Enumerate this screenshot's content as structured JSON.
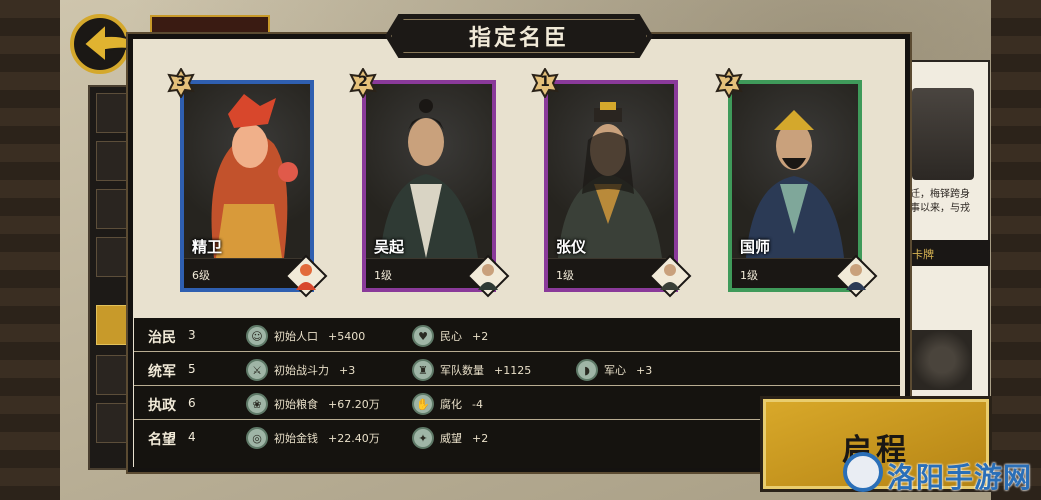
{
  "dialog": {
    "title": "指定名臣"
  },
  "cards": [
    {
      "name": "精卫",
      "level": "6级",
      "rank": "3",
      "border_color": "#2f5fb0"
    },
    {
      "name": "吴起",
      "level": "1级",
      "rank": "2",
      "border_color": "#8a3a9a"
    },
    {
      "name": "张仪",
      "level": "1级",
      "rank": "1",
      "border_color": "#8a3a9a"
    },
    {
      "name": "国师",
      "level": "1级",
      "rank": "2",
      "border_color": "#3f9a5a"
    }
  ],
  "stats": [
    {
      "name": "治民",
      "value": "3",
      "bonuses": [
        {
          "icon": "person-icon",
          "label": "初始人口",
          "amount": "+5400"
        },
        {
          "icon": "heart-icon",
          "label": "民心",
          "amount": "+2"
        }
      ]
    },
    {
      "name": "统军",
      "value": "5",
      "bonuses": [
        {
          "icon": "sword-icon",
          "label": "初始战斗力",
          "amount": "+3"
        },
        {
          "icon": "soldier-icon",
          "label": "军队数量",
          "amount": "+1125"
        },
        {
          "icon": "helmet-icon",
          "label": "军心",
          "amount": "+3"
        }
      ]
    },
    {
      "name": "执政",
      "value": "6",
      "bonuses": [
        {
          "icon": "grain-icon",
          "label": "初始粮食",
          "amount": "+67.20万"
        },
        {
          "icon": "corruption-icon",
          "label": "腐化",
          "amount": "-4"
        }
      ]
    },
    {
      "name": "名望",
      "value": "4",
      "bonuses": [
        {
          "icon": "coin-icon",
          "label": "初始金钱",
          "amount": "+22.40万"
        },
        {
          "icon": "prestige-icon",
          "label": "威望",
          "amount": "+2"
        }
      ]
    }
  ],
  "start_button": {
    "label": "启程"
  },
  "watermark": {
    "text": "洛阳手游网"
  },
  "background": {
    "right_text": "迁，梅铎跨身\n事以来，与戎",
    "right_strip": "卡牌"
  },
  "colors": {
    "gold": "#d4a82c",
    "dark": "#15130f",
    "paper": "#e8e1cf"
  }
}
